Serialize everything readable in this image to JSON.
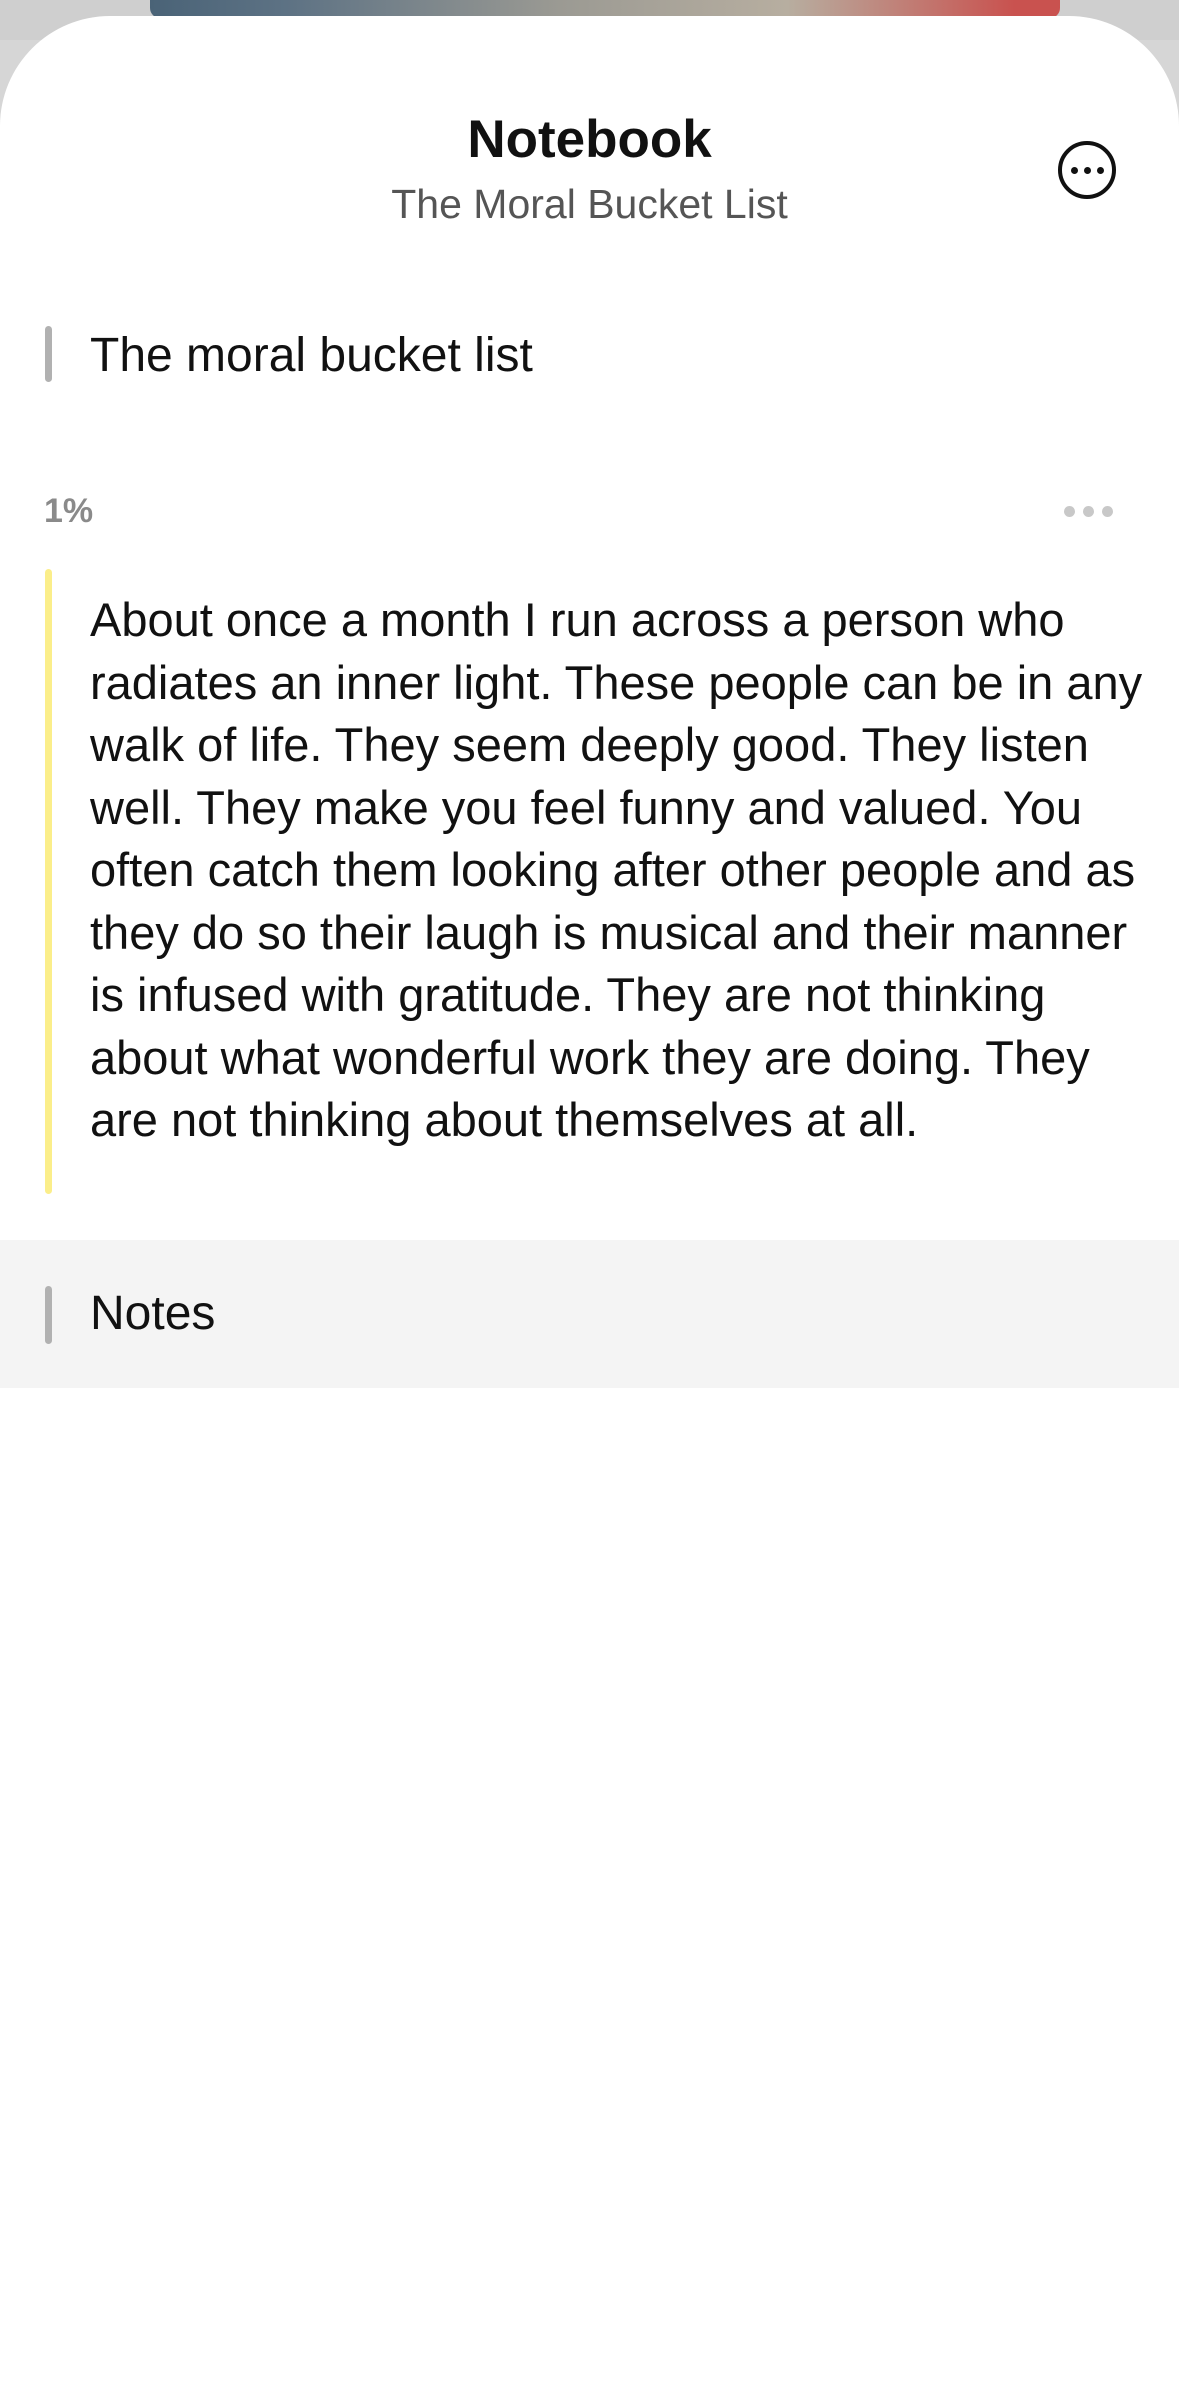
{
  "header": {
    "title": "Notebook",
    "subtitle": "The Moral Bucket List",
    "more_icon": "ellipsis-circle-icon"
  },
  "chapter": {
    "label": "The moral bucket list"
  },
  "highlight": {
    "progress": "1%",
    "progress_value": 0.01,
    "menu_icon": "ellipsis-horizontal-icon",
    "highlight_color": "#fbee8a",
    "text": "About once a month I run across a person who radiates an inner light. These people can be in any walk of life. They seem deeply good. They listen well. They make you feel funny and valued. You often catch them looking after other people and as they do so their laugh is musical and their manner is infused with gratitude. They are not thinking about what wonderful work they are doing. They are not thinking about themselves at all."
  },
  "notes": {
    "label": "Notes"
  },
  "colors": {
    "background": "#ffffff",
    "notes_background": "#f4f4f4",
    "chapter_bar": "#b1b1b1",
    "text": "#111111",
    "muted": "#8a8a8a"
  }
}
